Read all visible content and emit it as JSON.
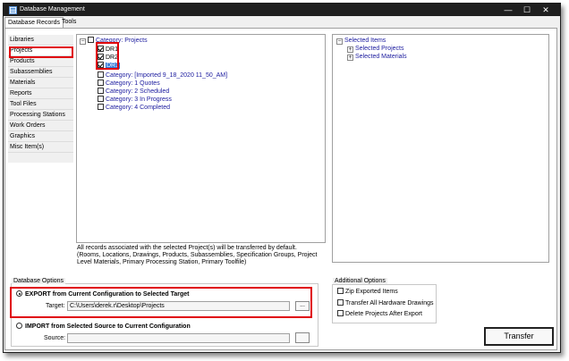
{
  "window": {
    "title": "Database Management",
    "minimize": "—",
    "maximize": "☐",
    "close": "✕"
  },
  "tabs": [
    {
      "label": "Database Records"
    },
    {
      "label": "Tools"
    }
  ],
  "nav": [
    {
      "label": "Libraries"
    },
    {
      "label": "Projects"
    },
    {
      "label": "Products"
    },
    {
      "label": "Subassemblies"
    },
    {
      "label": "Materials"
    },
    {
      "label": "Reports"
    },
    {
      "label": "Tool Files"
    },
    {
      "label": "Processing Stations"
    },
    {
      "label": "Work Orders"
    },
    {
      "label": "Graphics"
    },
    {
      "label": "Misc Item(s)"
    }
  ],
  "tree": {
    "root": "Category: Projects",
    "items": [
      "DR1",
      "DR2",
      "DR3"
    ],
    "categories": [
      "Category: [Imported 9_18_2020 11_50_AM]",
      "Category: 1 Quotes",
      "Category: 2 Scheduled",
      "Category: 3 In Progress",
      "Category: 4 Completed"
    ]
  },
  "note": {
    "line1": "All records associated with the selected Project(s) will be transferred by default.",
    "line2": "(Rooms, Locations, Drawings, Products, Subassemblies, Specification Groups, Project",
    "line3": "Level Materials, Primary Processing Station, Primary Toolfile)"
  },
  "selected": {
    "root": "Selected Items",
    "projects": "Selected Projects",
    "materials": "Selected Materials"
  },
  "db_options": {
    "legend": "Database Options",
    "export_label": "EXPORT from Current Configuration to Selected Target",
    "target_label": "Target:",
    "target_value": "C:\\Users\\derek.r\\Desktop\\Projects",
    "browse": "...",
    "import_label": "IMPORT from Selected Source to Current Configuration",
    "source_label": "Source:",
    "source_value": ""
  },
  "additional": {
    "legend": "Additional Options",
    "zip": "Zip Exported Items",
    "hardware": "Transfer All Hardware Drawings",
    "delete": "Delete Projects After Export"
  },
  "transfer": "Transfer"
}
